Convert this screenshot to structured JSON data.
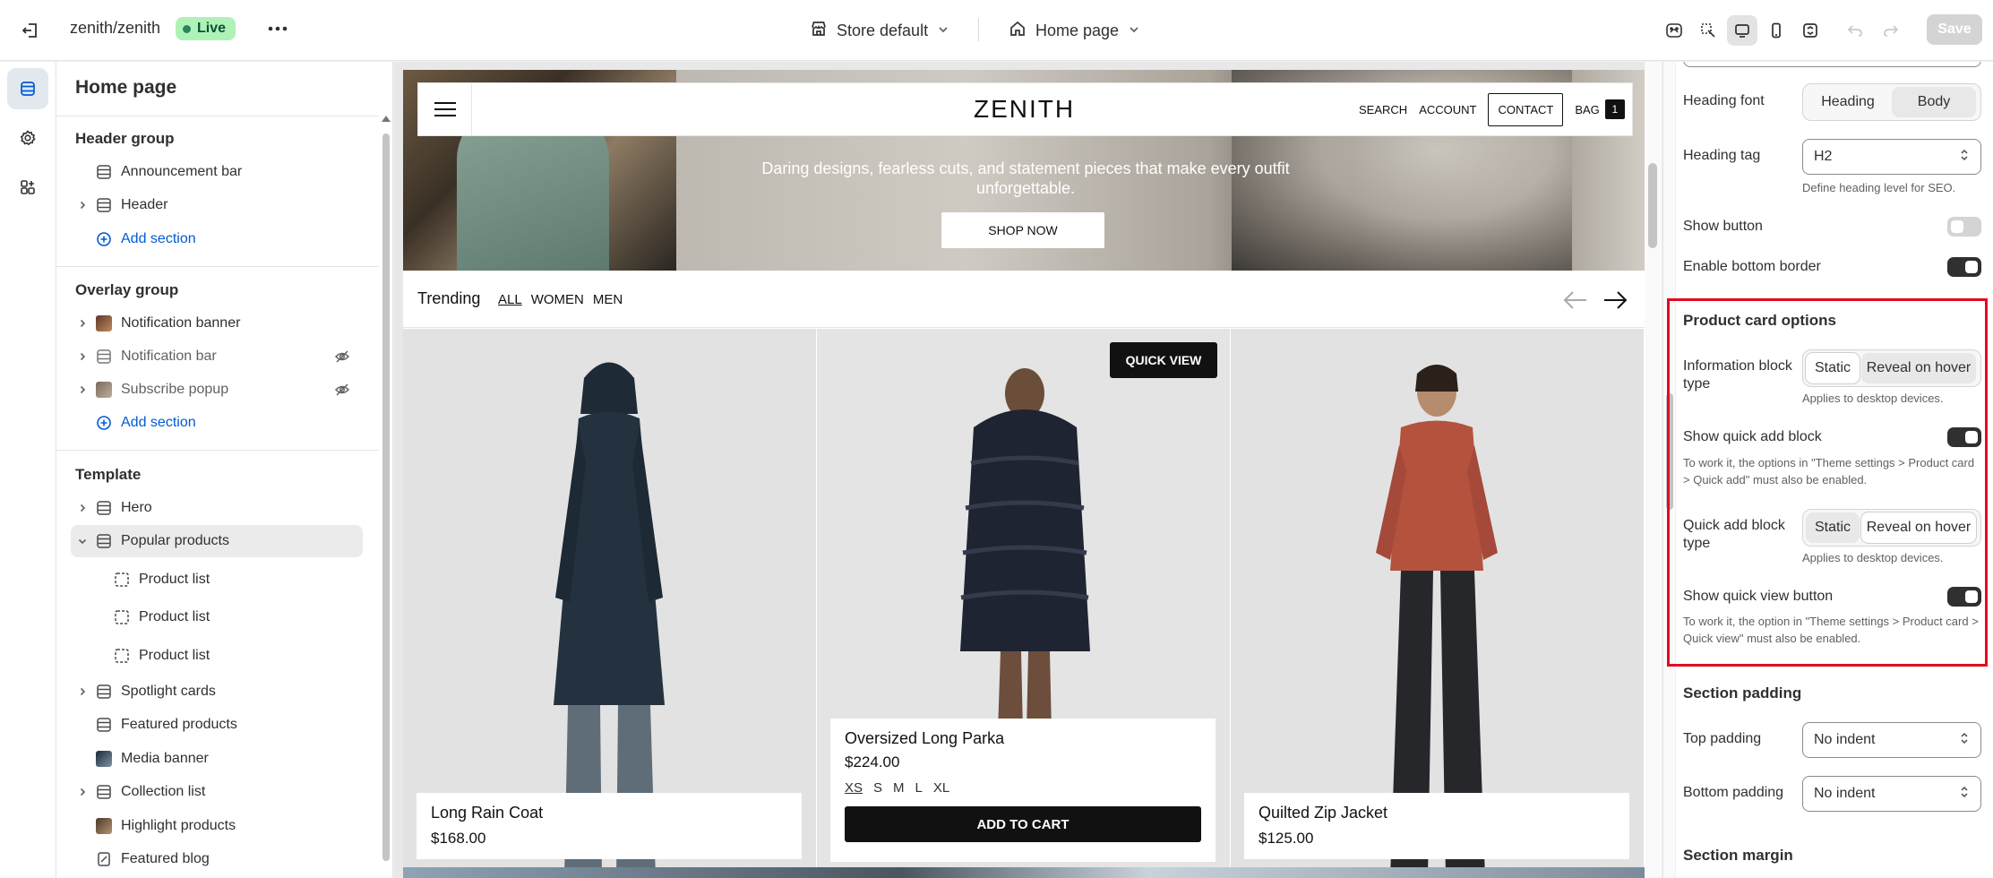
{
  "topbar": {
    "store_name": "zenith/zenith",
    "live_label": "Live",
    "context_label": "Store default",
    "page_label": "Home page",
    "save_label": "Save"
  },
  "sidebar": {
    "title": "Home page",
    "header_group": {
      "title": "Header group",
      "items": [
        "Announcement bar",
        "Header"
      ],
      "add_label": "Add section"
    },
    "overlay_group": {
      "title": "Overlay group",
      "items": [
        "Notification banner",
        "Notification bar",
        "Subscribe popup"
      ],
      "add_label": "Add section"
    },
    "template": {
      "title": "Template",
      "items": [
        "Hero",
        "Popular products",
        "Product list",
        "Product list",
        "Product list",
        "Spotlight cards",
        "Featured products",
        "Media banner",
        "Collection list",
        "Highlight products",
        "Featured blog"
      ]
    }
  },
  "preview": {
    "logo": "ZENITH",
    "nav_links": {
      "search": "SEARCH",
      "account": "ACCOUNT",
      "contact": "CONTACT",
      "bag": "BAG",
      "bag_count": "1"
    },
    "hero_text": "Daring designs, fearless cuts, and statement pieces that make every outfit unforgettable.",
    "hero_button": "SHOP NOW",
    "trending_title": "Trending",
    "tabs": [
      "ALL",
      "WOMEN",
      "MEN"
    ],
    "quick_view": "QUICK VIEW",
    "products": [
      {
        "name": "Long Rain Coat",
        "price": "$168.00"
      },
      {
        "name": "Oversized Long Parka",
        "price": "$224.00",
        "sizes": [
          "XS",
          "S",
          "M",
          "L",
          "XL"
        ],
        "add_to_cart": "ADD TO CART"
      },
      {
        "name": "Quilted Zip Jacket",
        "price": "$125.00"
      }
    ]
  },
  "settings": {
    "heading_font_label": "Heading font",
    "heading_font_options": [
      "Heading",
      "Body"
    ],
    "heading_tag_label": "Heading tag",
    "heading_tag_value": "H2",
    "heading_tag_help": "Define heading level for SEO.",
    "show_button_label": "Show button",
    "show_button": false,
    "bottom_border_label": "Enable bottom border",
    "bottom_border": true,
    "product_card_title": "Product card options",
    "info_block_label": "Information block type",
    "info_block_options": [
      "Static",
      "Reveal on hover"
    ],
    "info_block_help": "Applies to desktop devices.",
    "quick_add_label": "Show quick add block",
    "quick_add": true,
    "quick_add_help": "To work it, the options in \"Theme settings > Product card > Quick add\" must also be enabled.",
    "quick_add_type_label": "Quick add block type",
    "quick_add_type_options": [
      "Static",
      "Reveal on hover"
    ],
    "quick_add_type_help": "Applies to desktop devices.",
    "quick_view_label": "Show quick view button",
    "quick_view": true,
    "quick_view_help": "To work it, the option in \"Theme settings > Product card > Quick view\" must also be enabled.",
    "section_padding_title": "Section padding",
    "top_padding_label": "Top padding",
    "top_padding_value": "No indent",
    "bottom_padding_label": "Bottom padding",
    "bottom_padding_value": "No indent",
    "section_margin_title": "Section margin"
  },
  "colors": {
    "live_bg": "#aff2b8",
    "highlight": "#e00b1f",
    "link": "#005bd3"
  }
}
